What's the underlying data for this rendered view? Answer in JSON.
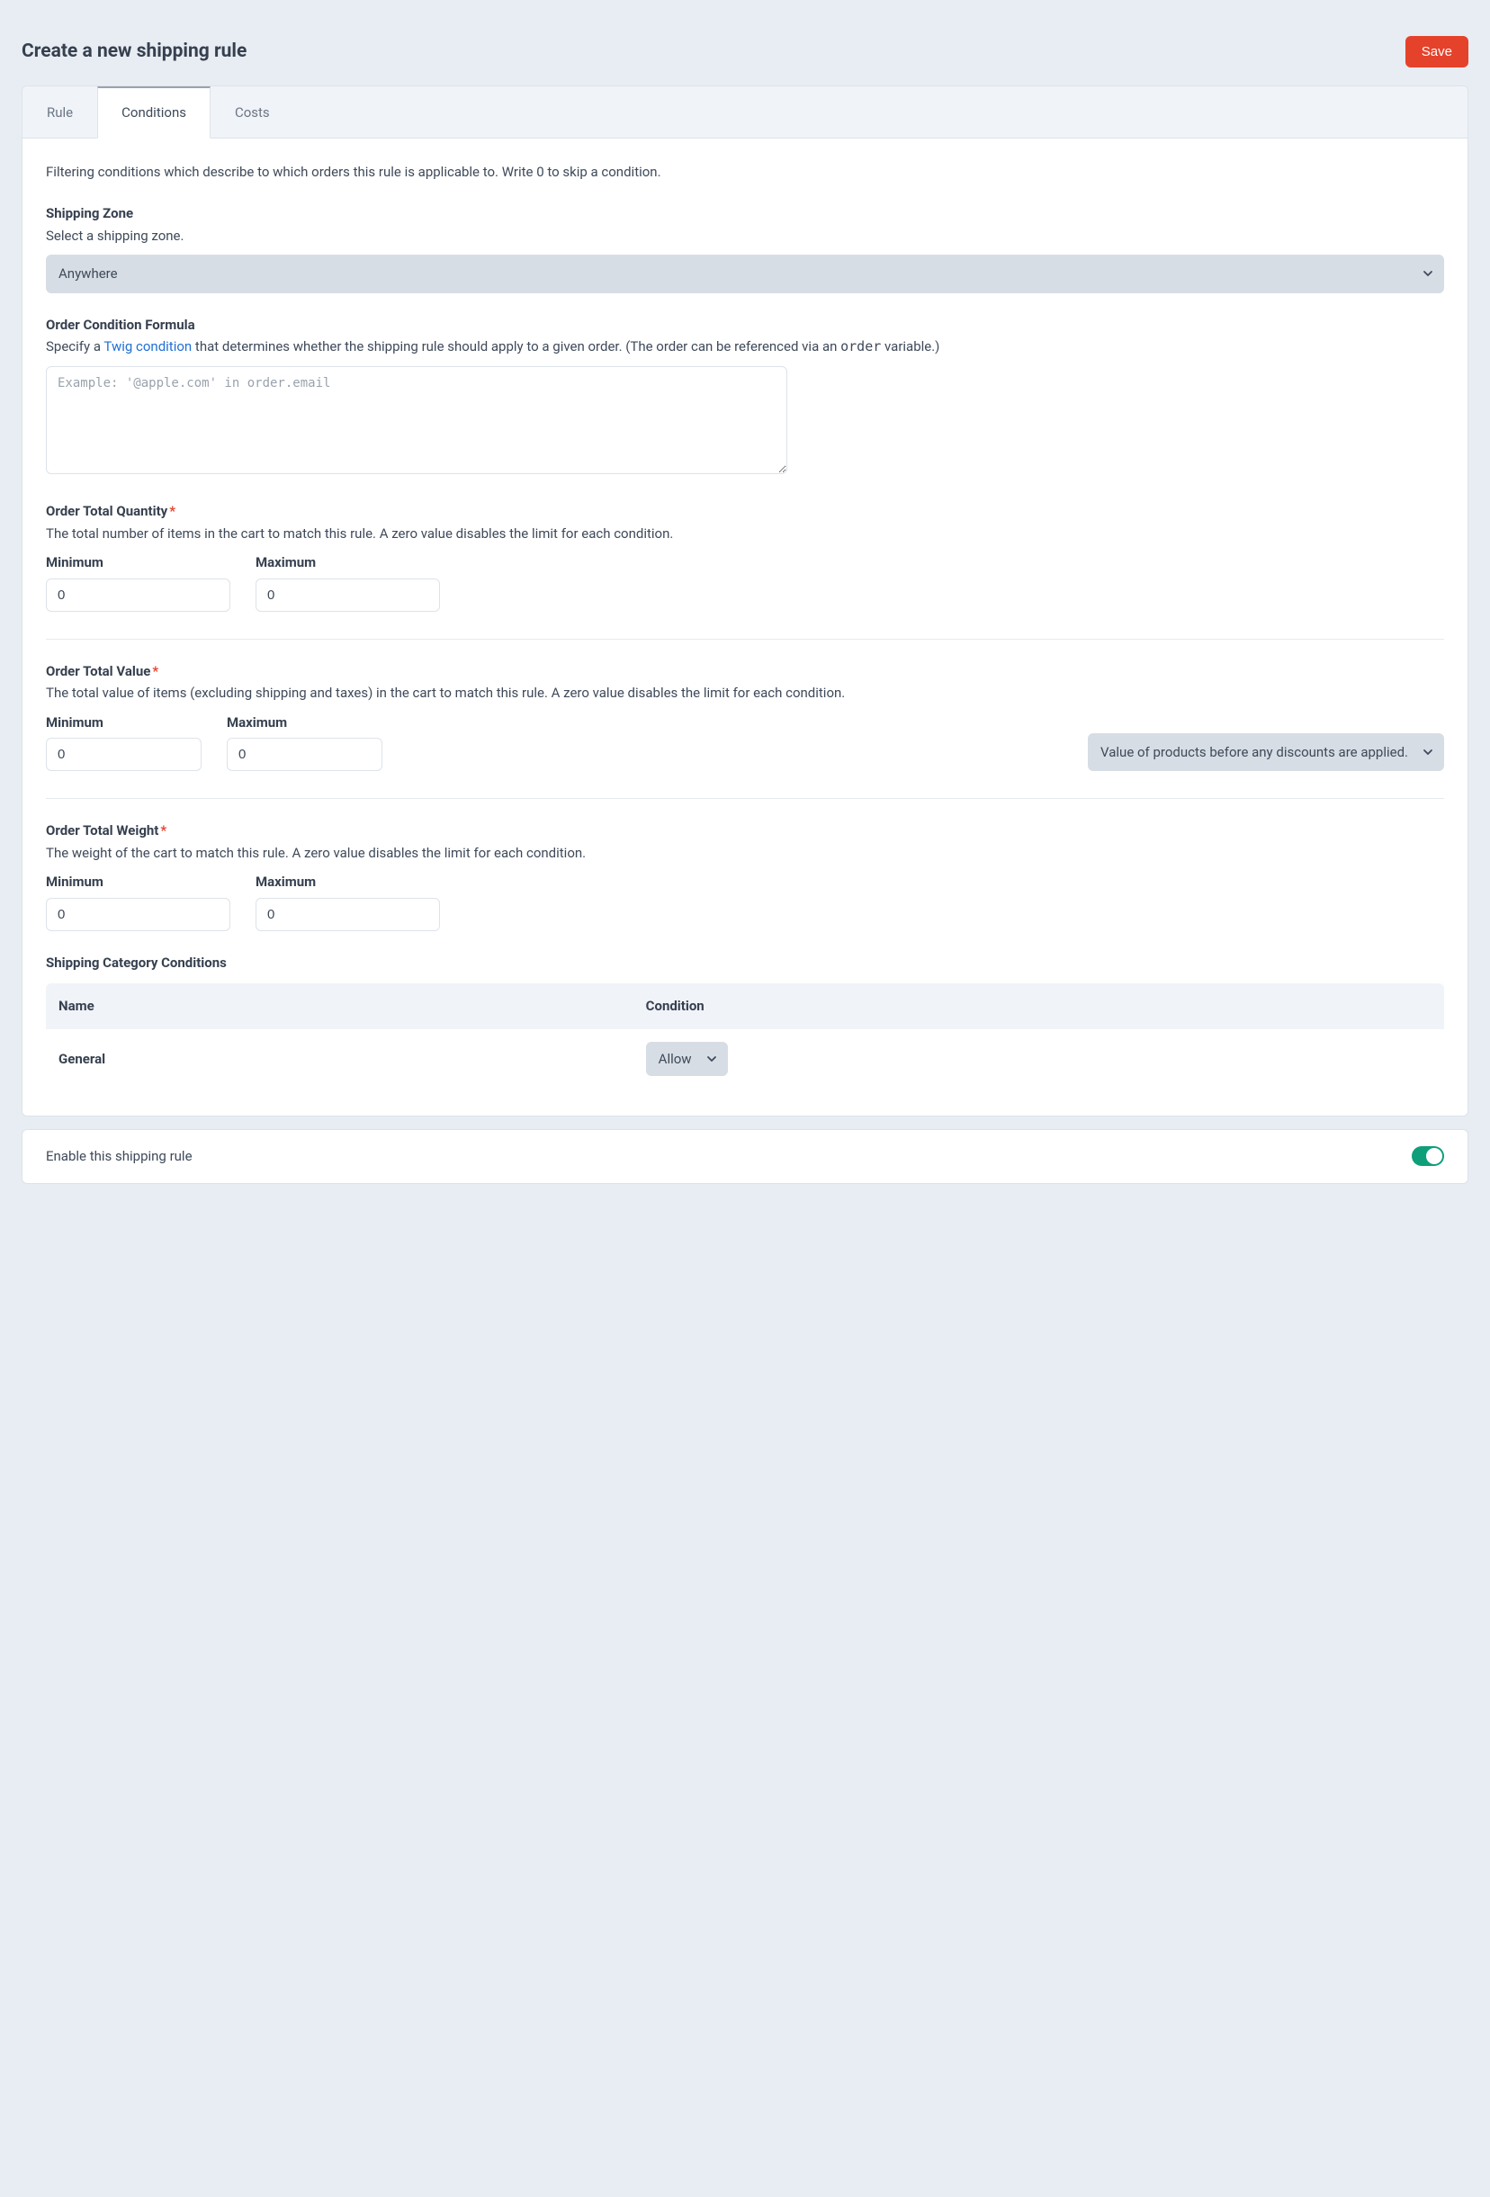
{
  "header": {
    "title": "Create a new shipping rule",
    "save_label": "Save"
  },
  "tabs": {
    "rule": "Rule",
    "conditions": "Conditions",
    "costs": "Costs"
  },
  "panel": {
    "description": "Filtering conditions which describe to which orders this rule is applicable to. Write 0 to skip a condition."
  },
  "shipping_zone": {
    "label": "Shipping Zone",
    "help": "Select a shipping zone.",
    "value": "Anywhere"
  },
  "order_condition": {
    "label": "Order Condition Formula",
    "help_prefix": "Specify a ",
    "link_text": "Twig condition",
    "help_mid": " that determines whether the shipping rule should apply to a given order. (The order can be referenced via an ",
    "code_var": "order",
    "help_suffix": " variable.)",
    "placeholder": "Example: '@apple.com' in order.email"
  },
  "total_quantity": {
    "label": "Order Total Quantity",
    "help": "The total number of items in the cart to match this rule. A zero value disables the limit for each condition.",
    "min_label": "Minimum",
    "max_label": "Maximum",
    "min_value": "0",
    "max_value": "0"
  },
  "total_value": {
    "label": "Order Total Value",
    "help": "The total value of items (excluding shipping and taxes) in the cart to match this rule. A zero value disables the limit for each condition.",
    "min_label": "Minimum",
    "max_label": "Maximum",
    "min_value": "0",
    "max_value": "0",
    "select_value": "Value of products before any discounts are applied."
  },
  "total_weight": {
    "label": "Order Total Weight",
    "help": "The weight of the cart to match this rule. A zero value disables the limit for each condition.",
    "min_label": "Minimum",
    "max_label": "Maximum",
    "min_value": "0",
    "max_value": "0"
  },
  "category_conditions": {
    "label": "Shipping Category Conditions",
    "col_name": "Name",
    "col_condition": "Condition",
    "row_name": "General",
    "row_value": "Allow"
  },
  "enable": {
    "label": "Enable this shipping rule",
    "on": true
  }
}
